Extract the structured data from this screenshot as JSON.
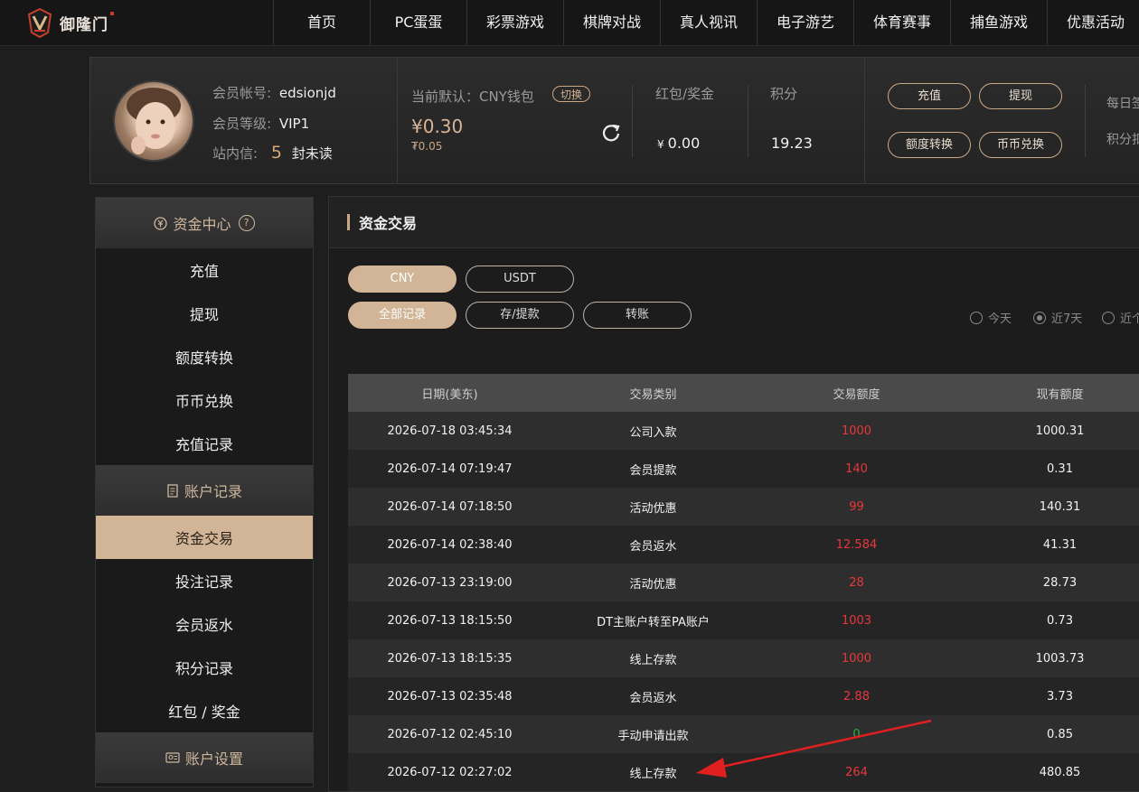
{
  "nav": {
    "logo_text": "御隆门",
    "items": [
      "首页",
      "PC蛋蛋",
      "彩票游戏",
      "棋牌对战",
      "真人视讯",
      "电子游艺",
      "体育赛事",
      "捕鱼游戏",
      "优惠活动"
    ]
  },
  "member": {
    "account_label": "会员帐号:",
    "account": "edsionjd",
    "level_label": "会员等级:",
    "level": "VIP1",
    "mail_label": "站内信:",
    "mail_count": "5",
    "mail_suffix": "封未读",
    "wallet_label": "当前默认：CNY钱包",
    "switch_label": "切换",
    "balance": "¥0.30",
    "balance_sub": "₮0.05",
    "redpack_label": "红包/奖金",
    "redpack_currency": "¥",
    "redpack_value": "0.00",
    "points_label": "积分",
    "points_value": "19.23",
    "buttons": [
      "充值",
      "提现",
      "额度转换",
      "币币兑换"
    ],
    "partial_1": "每日签",
    "partial_2": "积分扣"
  },
  "sidebar": {
    "sections": [
      {
        "title": "资金中心",
        "help": "?",
        "items": [
          "充值",
          "提现",
          "额度转换",
          "币币兑换",
          "充值记录"
        ]
      },
      {
        "title": "账户记录",
        "items": [
          "资金交易",
          "投注记录",
          "会员返水",
          "积分记录",
          "红包 / 奖金"
        ]
      },
      {
        "title": "账户设置"
      }
    ]
  },
  "main": {
    "title": "资金交易",
    "currency_tabs": [
      "CNY",
      "USDT"
    ],
    "type_tabs": [
      "全部记录",
      "存/提款",
      "转账"
    ],
    "range_options": [
      "今天",
      "近7天",
      "近个"
    ],
    "table": {
      "headers": [
        "日期(美东)",
        "交易类别",
        "交易额度",
        "现有额度"
      ],
      "rows": [
        {
          "date": "2026-07-18 03:45:34",
          "type": "公司入款",
          "amount": "1000",
          "balance": "1000.31",
          "color": "#e8383b"
        },
        {
          "date": "2026-07-14 07:19:47",
          "type": "会员提款",
          "amount": "140",
          "balance": "0.31",
          "color": "#e8383b"
        },
        {
          "date": "2026-07-14 07:18:50",
          "type": "活动优惠",
          "amount": "99",
          "balance": "140.31",
          "color": "#e8383b"
        },
        {
          "date": "2026-07-14 02:38:40",
          "type": "会员返水",
          "amount": "12.584",
          "balance": "41.31",
          "color": "#e8383b"
        },
        {
          "date": "2026-07-13 23:19:00",
          "type": "活动优惠",
          "amount": "28",
          "balance": "28.73",
          "color": "#e8383b"
        },
        {
          "date": "2026-07-13 18:15:50",
          "type": "DT主账户转至PA账户",
          "amount": "1003",
          "balance": "0.73",
          "color": "#e8383b"
        },
        {
          "date": "2026-07-13 18:15:35",
          "type": "线上存款",
          "amount": "1000",
          "balance": "1003.73",
          "color": "#e8383b"
        },
        {
          "date": "2026-07-13 02:35:48",
          "type": "会员返水",
          "amount": "2.88",
          "balance": "3.73",
          "color": "#e8383b"
        },
        {
          "date": "2026-07-12 02:45:10",
          "type": "手动申请出款",
          "amount": "0",
          "balance": "0.85",
          "color": "#28b43c"
        },
        {
          "date": "2026-07-12 02:27:02",
          "type": "线上存款",
          "amount": "264",
          "balance": "480.85",
          "color": "#e8383b"
        }
      ]
    }
  }
}
